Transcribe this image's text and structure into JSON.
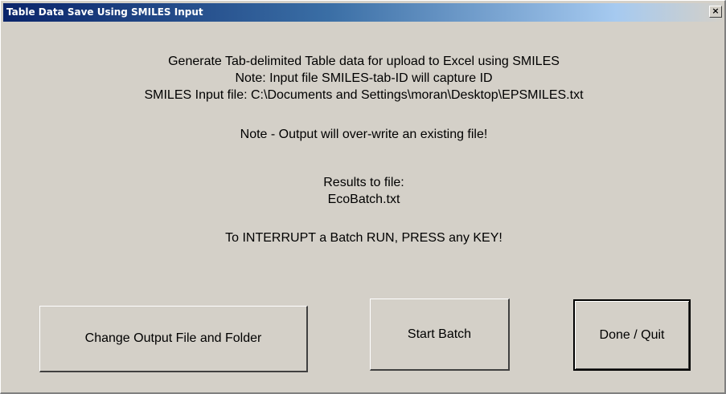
{
  "window": {
    "title": "Table Data Save Using SMILES Input",
    "close_label": "×"
  },
  "content": {
    "line1": "Generate Tab-delimited Table data for upload to Excel using SMILES",
    "line2": "Note: Input file SMILES-tab-ID will capture ID",
    "line3": "SMILES Input file: C:\\Documents and Settings\\moran\\Desktop\\EPSMILES.txt",
    "warning": "Note - Output will over-write an existing file!",
    "results_label": "Results to file:",
    "results_file": "EcoBatch.txt",
    "interrupt_note": "To INTERRUPT a Batch RUN, PRESS any KEY!"
  },
  "buttons": {
    "change_output": "Change Output File and Folder",
    "start_batch": "Start Batch",
    "done_quit": "Done / Quit"
  }
}
